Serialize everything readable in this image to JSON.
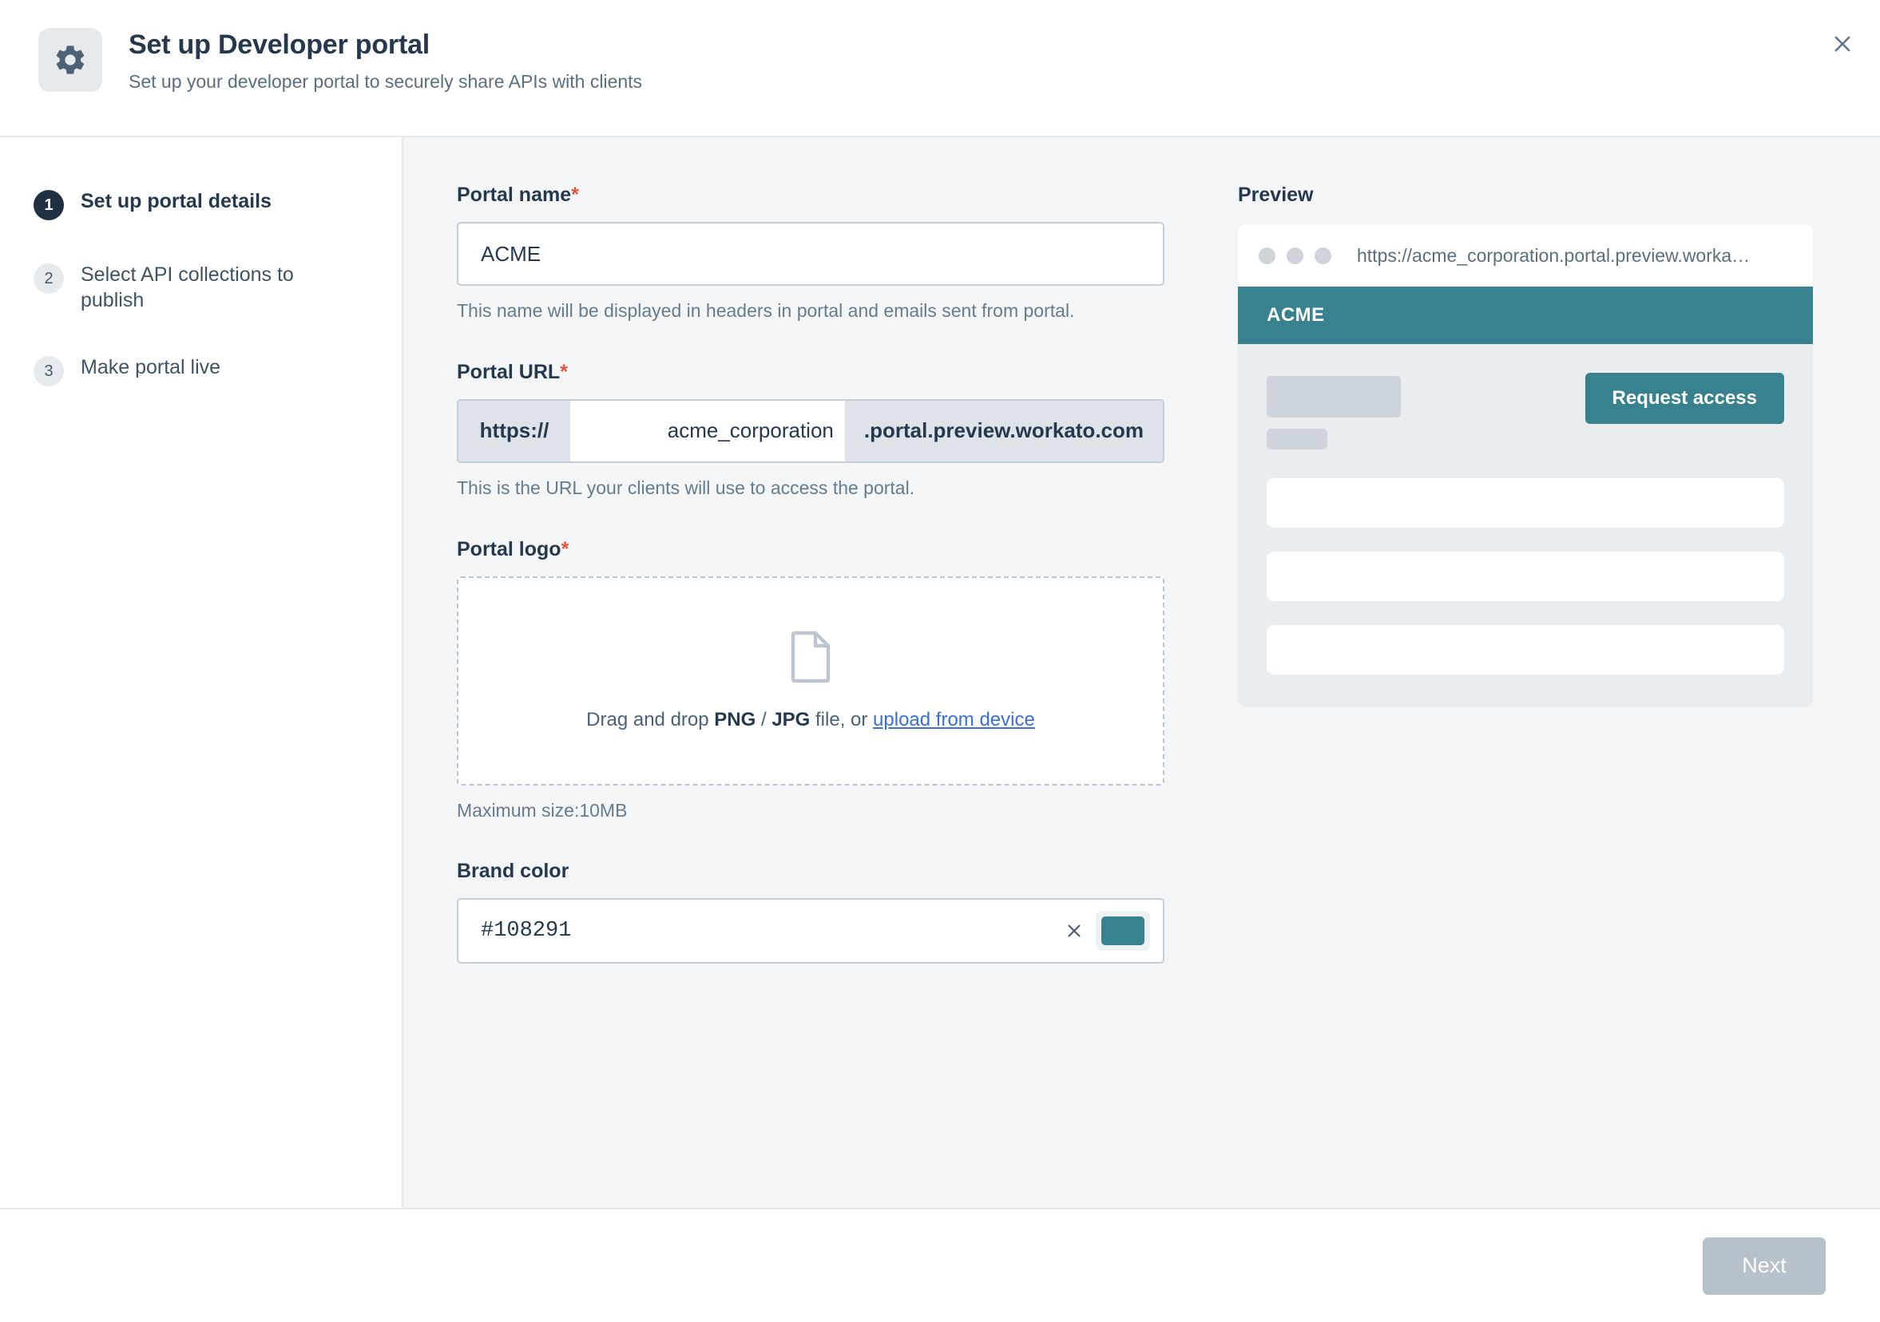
{
  "header": {
    "icon": "gear-icon",
    "title": "Set up Developer portal",
    "subtitle": "Set up your developer portal to securely share APIs with clients",
    "close_icon": "close-icon"
  },
  "sidebar": {
    "steps": [
      {
        "number": "1",
        "label": "Set up portal details",
        "active": true
      },
      {
        "number": "2",
        "label": "Select API collections to publish",
        "active": false
      },
      {
        "number": "3",
        "label": "Make portal live",
        "active": false
      }
    ]
  },
  "form": {
    "portal_name": {
      "label": "Portal name",
      "required": "*",
      "value": "ACME",
      "placeholder": "",
      "helper": "This name will be displayed in headers in portal and emails sent from portal."
    },
    "portal_url": {
      "label": "Portal URL",
      "required": "*",
      "prefix": "https://",
      "value": "acme_corporation",
      "placeholder": "",
      "suffix": ".portal.preview.workato.com",
      "helper": "This is the URL your clients will use to access the portal."
    },
    "portal_logo": {
      "label": "Portal logo",
      "required": "*",
      "icon": "file-icon",
      "drop_text_1": "Drag and drop ",
      "format_1": "PNG",
      "separator": " / ",
      "format_2": "JPG",
      "drop_text_2": " file, or ",
      "upload_link": "upload from device",
      "max_size": "Maximum size:10MB"
    },
    "brand_color": {
      "label": "Brand color",
      "value": "#108291",
      "placeholder": "",
      "clear_icon": "close-icon",
      "swatch_color": "#38818f"
    }
  },
  "preview": {
    "title": "Preview",
    "url": "https://acme_corporation.portal.preview.worka…",
    "brand_name": "ACME",
    "header_color": "#38818f",
    "request_access_label": "Request access"
  },
  "footer": {
    "next_label": "Next"
  }
}
